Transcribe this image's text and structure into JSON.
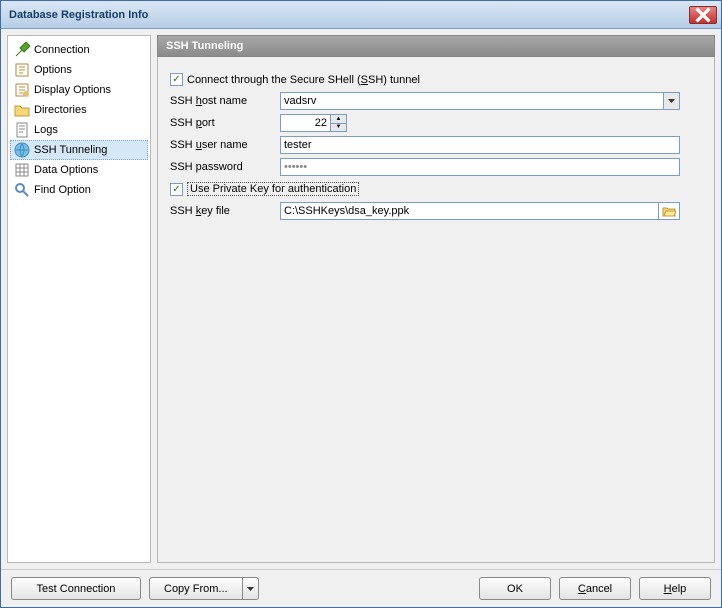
{
  "window": {
    "title": "Database Registration Info"
  },
  "sidebar": {
    "items": [
      {
        "label": "Connection",
        "icon": "connection"
      },
      {
        "label": "Options",
        "icon": "options"
      },
      {
        "label": "Display Options",
        "icon": "display"
      },
      {
        "label": "Directories",
        "icon": "directories"
      },
      {
        "label": "Logs",
        "icon": "logs"
      },
      {
        "label": "SSH Tunneling",
        "icon": "ssh",
        "selected": true
      },
      {
        "label": "Data Options",
        "icon": "data"
      },
      {
        "label": "Find Option",
        "icon": "find"
      }
    ]
  },
  "panel": {
    "title": "SSH Tunneling",
    "connect_through": {
      "checked": true,
      "pre": "Connect through the Secure SHell (",
      "accel": "S",
      "post": "SH) tunnel"
    },
    "fields": {
      "host_label_pre": "SSH ",
      "host_accel": "h",
      "host_label_post": "ost name",
      "host_value": "vadsrv",
      "port_label_pre": "SSH ",
      "port_accel": "p",
      "port_label_post": "ort",
      "port_value": "22",
      "user_label_pre": "SSH ",
      "user_accel": "u",
      "user_label_post": "ser name",
      "user_value": "tester",
      "pw_label": "SSH password",
      "pw_value": "••••••",
      "use_pk": {
        "checked": true,
        "label": "Use Private Key for authentication"
      },
      "key_label_pre": "SSH ",
      "key_accel": "k",
      "key_label_post": "ey file",
      "key_value": "C:\\SSHKeys\\dsa_key.ppk"
    }
  },
  "footer": {
    "test": "Test Connection",
    "copy": "Copy From...",
    "ok": "OK",
    "cancel_pre": "",
    "cancel_accel": "C",
    "cancel_post": "ancel",
    "help_pre": "",
    "help_accel": "H",
    "help_post": "elp"
  }
}
